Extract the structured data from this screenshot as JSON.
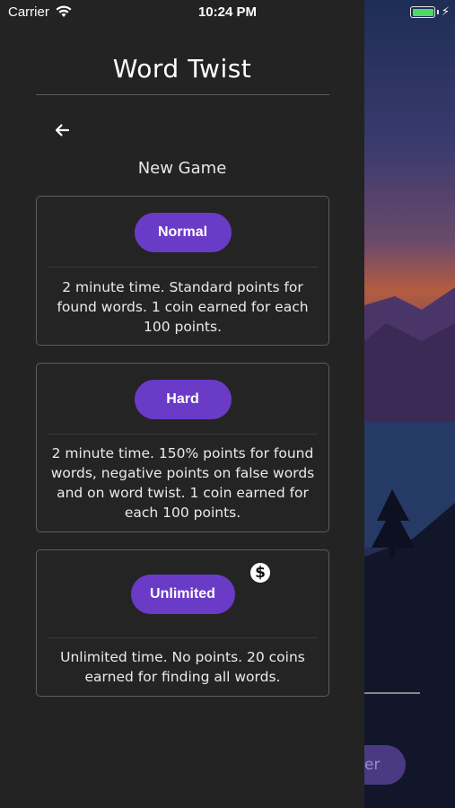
{
  "status_bar": {
    "carrier": "Carrier",
    "time": "10:24 PM",
    "battery_level": 1.0
  },
  "app": {
    "title": "Word Twist"
  },
  "screen": {
    "title": "New Game",
    "back_icon": "arrow-left-icon"
  },
  "modes": [
    {
      "label": "Normal",
      "description": "2 minute time. Standard points for found words. 1 coin earned for each 100 points."
    },
    {
      "label": "Hard",
      "description": "2 minute time. 150% points for found words, negative points on false words and on word twist. 1 coin earned for each 100 points."
    },
    {
      "label": "Unlimited",
      "badge": "$",
      "badge_icon": "coin-dollar-icon",
      "description": "Unlimited time. No points. 20 coins earned for finding all words."
    }
  ],
  "background": {
    "partial_button_text": "er"
  },
  "colors": {
    "accent": "#6a3bc7",
    "drawer_bg": "#232323",
    "card_border": "#5c5c5c",
    "battery": "#4cd964"
  }
}
